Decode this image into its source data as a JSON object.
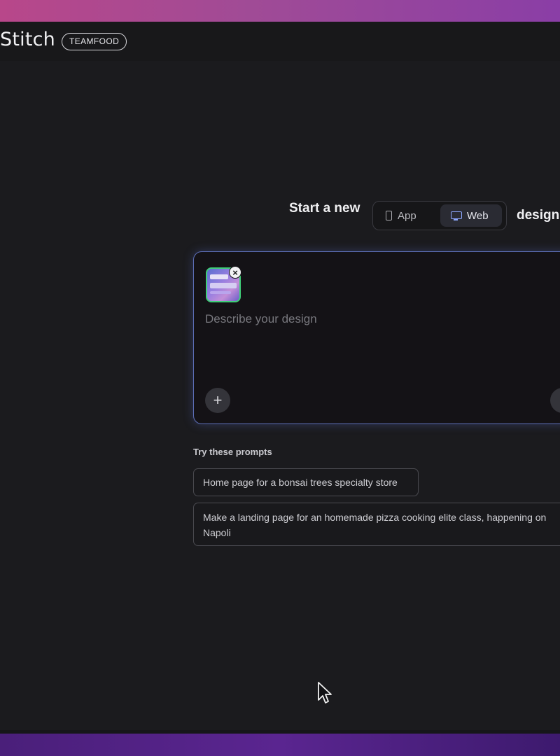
{
  "header": {
    "brand": "Stitch",
    "badge": "TEAMFOOD"
  },
  "start": {
    "text": "Start a new",
    "suffix": "design",
    "options": [
      {
        "label": "App",
        "icon": "phone-icon",
        "active": false
      },
      {
        "label": "Web",
        "icon": "monitor-icon",
        "active": true
      }
    ]
  },
  "prompt": {
    "placeholder": "Describe your design",
    "value": ""
  },
  "suggestions": {
    "title": "Try these prompts",
    "items": [
      "Home page for a bonsai trees specialty store",
      "Make a landing page for an homemade pizza cooking elite class, happening on Napoli"
    ]
  },
  "colors": {
    "accent": "#8ea8ff",
    "thumb_border": "#3fcf78",
    "background": "#1b1b1e"
  }
}
